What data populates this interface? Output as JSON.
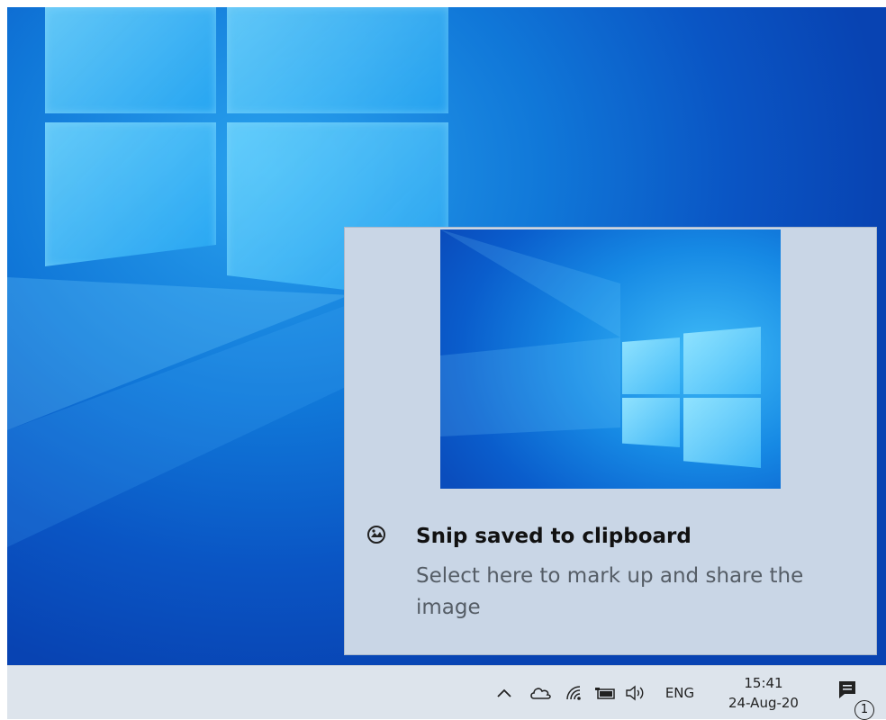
{
  "notification": {
    "app_icon": "snip-sketch-icon",
    "title": "Snip saved to clipboard",
    "body": "Select here to mark up and share the image"
  },
  "taskbar": {
    "tray_icons": [
      "chevron-up-icon",
      "onedrive-cloud-icon",
      "wifi-icon",
      "battery-icon",
      "volume-icon"
    ],
    "language": "ENG",
    "time": "15:41",
    "date": "24-Aug-20",
    "action_center": {
      "icon": "notification-icon",
      "badge_count": "1"
    }
  },
  "colors": {
    "desktop_accent": "#0a55c4",
    "toast_background": "#c9d6e6",
    "taskbar_background": "#dde4ec"
  }
}
